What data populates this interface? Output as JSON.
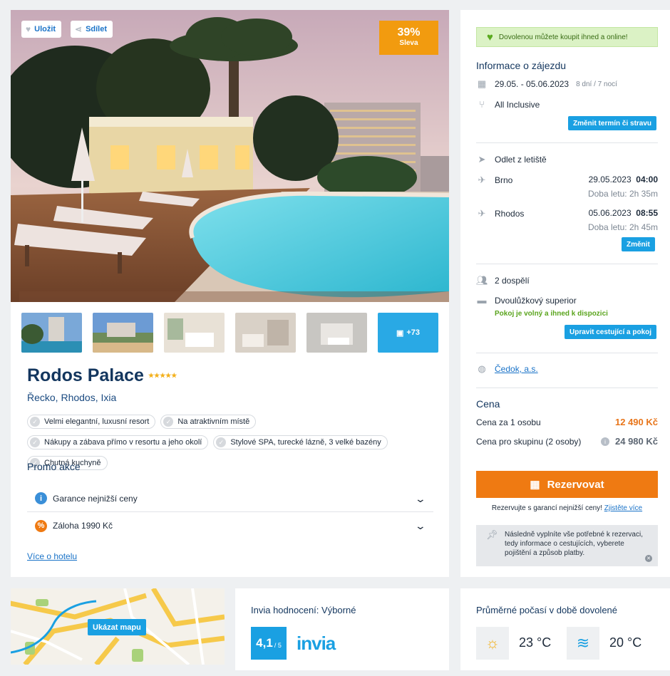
{
  "hero": {
    "save_label": "Uložit",
    "share_label": "Sdílet",
    "discount_pct": "39%",
    "discount_label": "Sleva"
  },
  "thumbs": {
    "more_label": "+73"
  },
  "hotel": {
    "name": "Rodos Palace",
    "stars": "★★★★★",
    "location": "Řecko, Rhodos, Ixia",
    "tags": [
      "Velmi elegantní, luxusní resort",
      "Na atraktivním místě",
      "Nákupy a zábava přímo v resortu a jeho okolí",
      "Stylové SPA, turecké lázně, 3 velké bazény",
      "Chutná kuchyně"
    ],
    "more_link": "Více o hotelu"
  },
  "promo": {
    "heading": "Promo akce",
    "items": [
      "Garance nejnižší ceny",
      "Záloha 1990 Kč"
    ]
  },
  "sidebar": {
    "banner": "Dovolenou můžete koupit ihned a online!",
    "info_heading": "Informace o zájezdu",
    "dates": "29.05. - 05.06.2023",
    "duration": "8 dní / 7 nocí",
    "board": "All Inclusive",
    "change_term_btn": "Změnit termín či stravu",
    "departure_label": "Odlet z letiště",
    "flight_out": {
      "from": "Brno",
      "date": "29.05.2023",
      "time": "04:00",
      "duration": "Doba letu: 2h 35m"
    },
    "flight_back": {
      "from": "Rhodos",
      "date": "05.06.2023",
      "time": "08:55",
      "duration": "Doba letu: 2h 45m"
    },
    "change_btn": "Změnit",
    "travelers": "2 dospělí",
    "room": "Dvoulůžkový superior",
    "room_status": "Pokoj je volný a ihned k dispozici",
    "edit_travelers_btn": "Upravit cestující a pokoj",
    "operator": "Čedok, a.s.",
    "price_heading": "Cena",
    "price_person_label": "Cena za 1 osobu",
    "price_person": "12 490 Kč",
    "price_group_label": "Cena pro skupinu (2 osoby)",
    "price_group": "24 980 Kč",
    "reserve_btn": "Rezervovat",
    "guarantee_text": "Rezervujte s garancí nejnižší ceny!",
    "guarantee_link": "Zjistěte více",
    "note": "Následně vyplníte vše potřebné k rezervaci, tedy informace o cestujících, vyberete pojištění a způsob platby."
  },
  "map": {
    "button": "Ukázat mapu"
  },
  "rating": {
    "heading": "Invia hodnocení: Výborné",
    "score": "4,1",
    "scale": "/ 5",
    "brand": "invia"
  },
  "weather": {
    "heading": "Průměrné počasí v době dovolené",
    "air_temp": "23 °C",
    "water_temp": "20 °C"
  },
  "colors": {
    "accent_blue": "#1aa0e2",
    "title_navy": "#13365e",
    "discount_orange": "#f29b0f",
    "reserve_orange": "#ef7a12",
    "success_green": "#5aa41d"
  }
}
